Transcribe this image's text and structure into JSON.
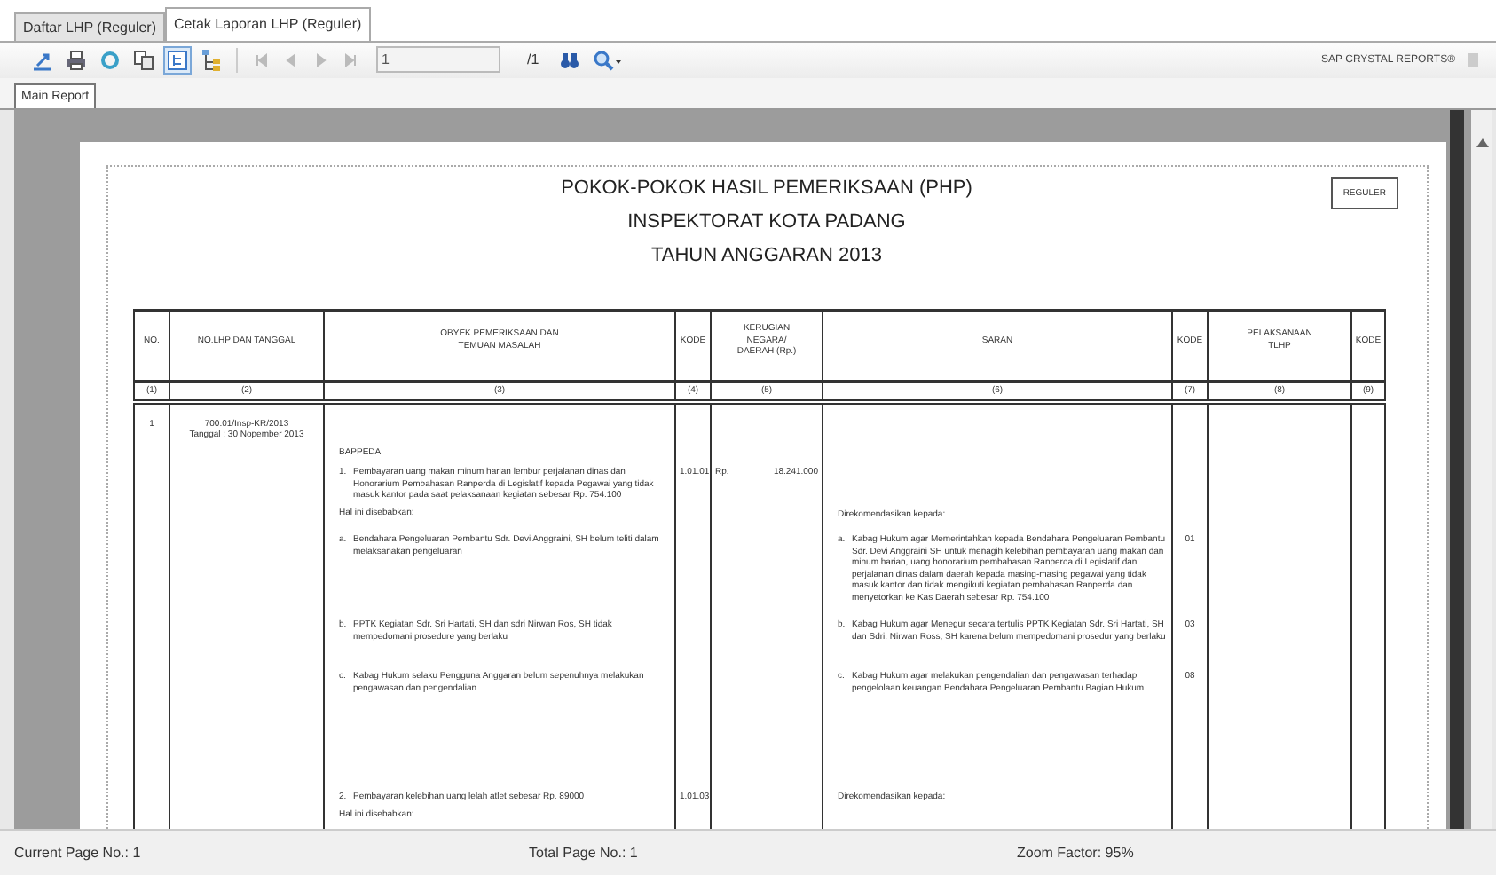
{
  "tabs": [
    {
      "label": "Daftar LHP (Reguler)",
      "selected": false
    },
    {
      "label": "Cetak Laporan LHP (Reguler)",
      "selected": true
    }
  ],
  "toolbar": {
    "tools": [
      {
        "kind": "export",
        "pressed": false
      },
      {
        "kind": "print",
        "pressed": false
      },
      {
        "kind": "refresh",
        "pressed": false
      },
      {
        "kind": "copy",
        "pressed": false
      },
      {
        "kind": "group-tree",
        "pressed": true
      },
      {
        "kind": "parameters",
        "pressed": false
      }
    ],
    "nav": [
      {
        "kind": "first",
        "disabled": true
      },
      {
        "kind": "prev",
        "disabled": true
      },
      {
        "kind": "next",
        "disabled": true
      },
      {
        "kind": "last",
        "disabled": true
      }
    ],
    "page_field": "1",
    "page_total": "/1",
    "brand": "SAP CRYSTAL REPORTS®"
  },
  "report_tabs": [
    {
      "label": "Main Report",
      "selected": true
    }
  ],
  "report": {
    "title_lines": [
      "POKOK-POKOK HASIL PEMERIKSAAN (PHP)",
      "INSPEKTORAT KOTA PADANG",
      "TAHUN ANGGARAN 2013"
    ],
    "badge": "REGULER",
    "columns": [
      {
        "label": "NO.",
        "number": "(1)"
      },
      {
        "label": "NO.LHP DAN TANGGAL",
        "number": "(2)"
      },
      {
        "label": "OBYEK PEMERIKSAAN DAN\nTEMUAN MASALAH",
        "number": "(3)"
      },
      {
        "label": "KODE",
        "number": "(4)"
      },
      {
        "label": "KERUGIAN\nNEGARA/\nDAERAH (Rp.)",
        "number": "(5)"
      },
      {
        "label": "SARAN",
        "number": "(6)"
      },
      {
        "label": "KODE",
        "number": "(7)"
      },
      {
        "label": "PELAKSANAAN\nTLHP",
        "number": "(8)"
      },
      {
        "label": "KODE",
        "number": "(9)"
      }
    ],
    "rows": [
      {
        "no": "1",
        "lhp": [
          "700.01/Insp-KR/2013",
          "Tanggal : 30 Nopember 2013"
        ],
        "obyek": [
          {
            "text": "BAPPEDA"
          }
        ]
      },
      {
        "obyek": [
          {
            "marker": "1.",
            "text": "Pembayaran uang makan minum harian lembur perjalanan dinas dan Honorarium Pembahasan Ranperda di Legislatif kepada Pegawai yang tidak masuk kantor pada saat pelaksanaan kegiatan sebesar Rp. 754.100"
          },
          {
            "text": "Hal ini disebabkan:"
          }
        ],
        "kode": "1.01.01",
        "currency": "Rp.",
        "kerugian": "18.241.000",
        "saran": [
          {
            "text": "Direkomendasikan kepada:"
          }
        ]
      },
      {
        "obyek": [
          {
            "marker": "a.",
            "text": "Bendahara Pengeluaran Pembantu Sdr. Devi Anggraini, SH belum teliti dalam melaksanakan pengeluaran"
          }
        ],
        "saran": [
          {
            "marker": "a.",
            "text": "Kabag Hukum agar Memerintahkan kepada Bendahara Pengeluaran Pembantu Sdr. Devi Anggraini SH untuk menagih kelebihan pembayaran uang makan dan minum harian, uang honorarium pembahasan Ranperda di Legislatif dan perjalanan dinas dalam daerah kepada masing-masing pegawai yang tidak masuk kantor dan tidak mengikuti kegiatan pembahasan Ranperda dan menyetorkan ke Kas Daerah sebesar Rp. 754.100"
          }
        ],
        "saran_kode": "01"
      },
      {
        "obyek": [
          {
            "marker": "b.",
            "text": "PPTK Kegiatan Sdr. Sri Hartati, SH dan sdri Nirwan Ros, SH tidak mempedomani prosedure yang berlaku"
          }
        ],
        "saran": [
          {
            "marker": "b.",
            "text": "Kabag Hukum agar Menegur secara tertulis PPTK Kegiatan Sdr. Sri Hartati, SH dan Sdri. Nirwan Ross, SH karena belum mempedomani prosedur yang berlaku"
          }
        ],
        "saran_kode": "03"
      },
      {
        "obyek": [
          {
            "marker": "c.",
            "text": "Kabag Hukum selaku Pengguna Anggaran belum sepenuhnya melakukan pengawasan dan pengendalian"
          }
        ],
        "saran": [
          {
            "marker": "c.",
            "text": "Kabag Hukum agar melakukan pengendalian dan pengawasan terhadap pengelolaan keuangan Bendahara Pengeluaran Pembantu Bagian Hukum"
          }
        ],
        "saran_kode": "08"
      },
      {
        "obyek": [
          {
            "marker": "2.",
            "text": "Pembayaran kelebihan uang lelah atlet sebesar Rp. 89000"
          },
          {
            "text": "Hal ini disebabkan:"
          }
        ],
        "kode": "1.01.03",
        "saran": [
          {
            "text": "Direkomendasikan kepada:"
          }
        ]
      }
    ]
  },
  "status_bar": {
    "current_page": "Current Page No.: 1",
    "total_pages": "Total Page No.: 1",
    "zoom": "Zoom Factor: 95%"
  }
}
